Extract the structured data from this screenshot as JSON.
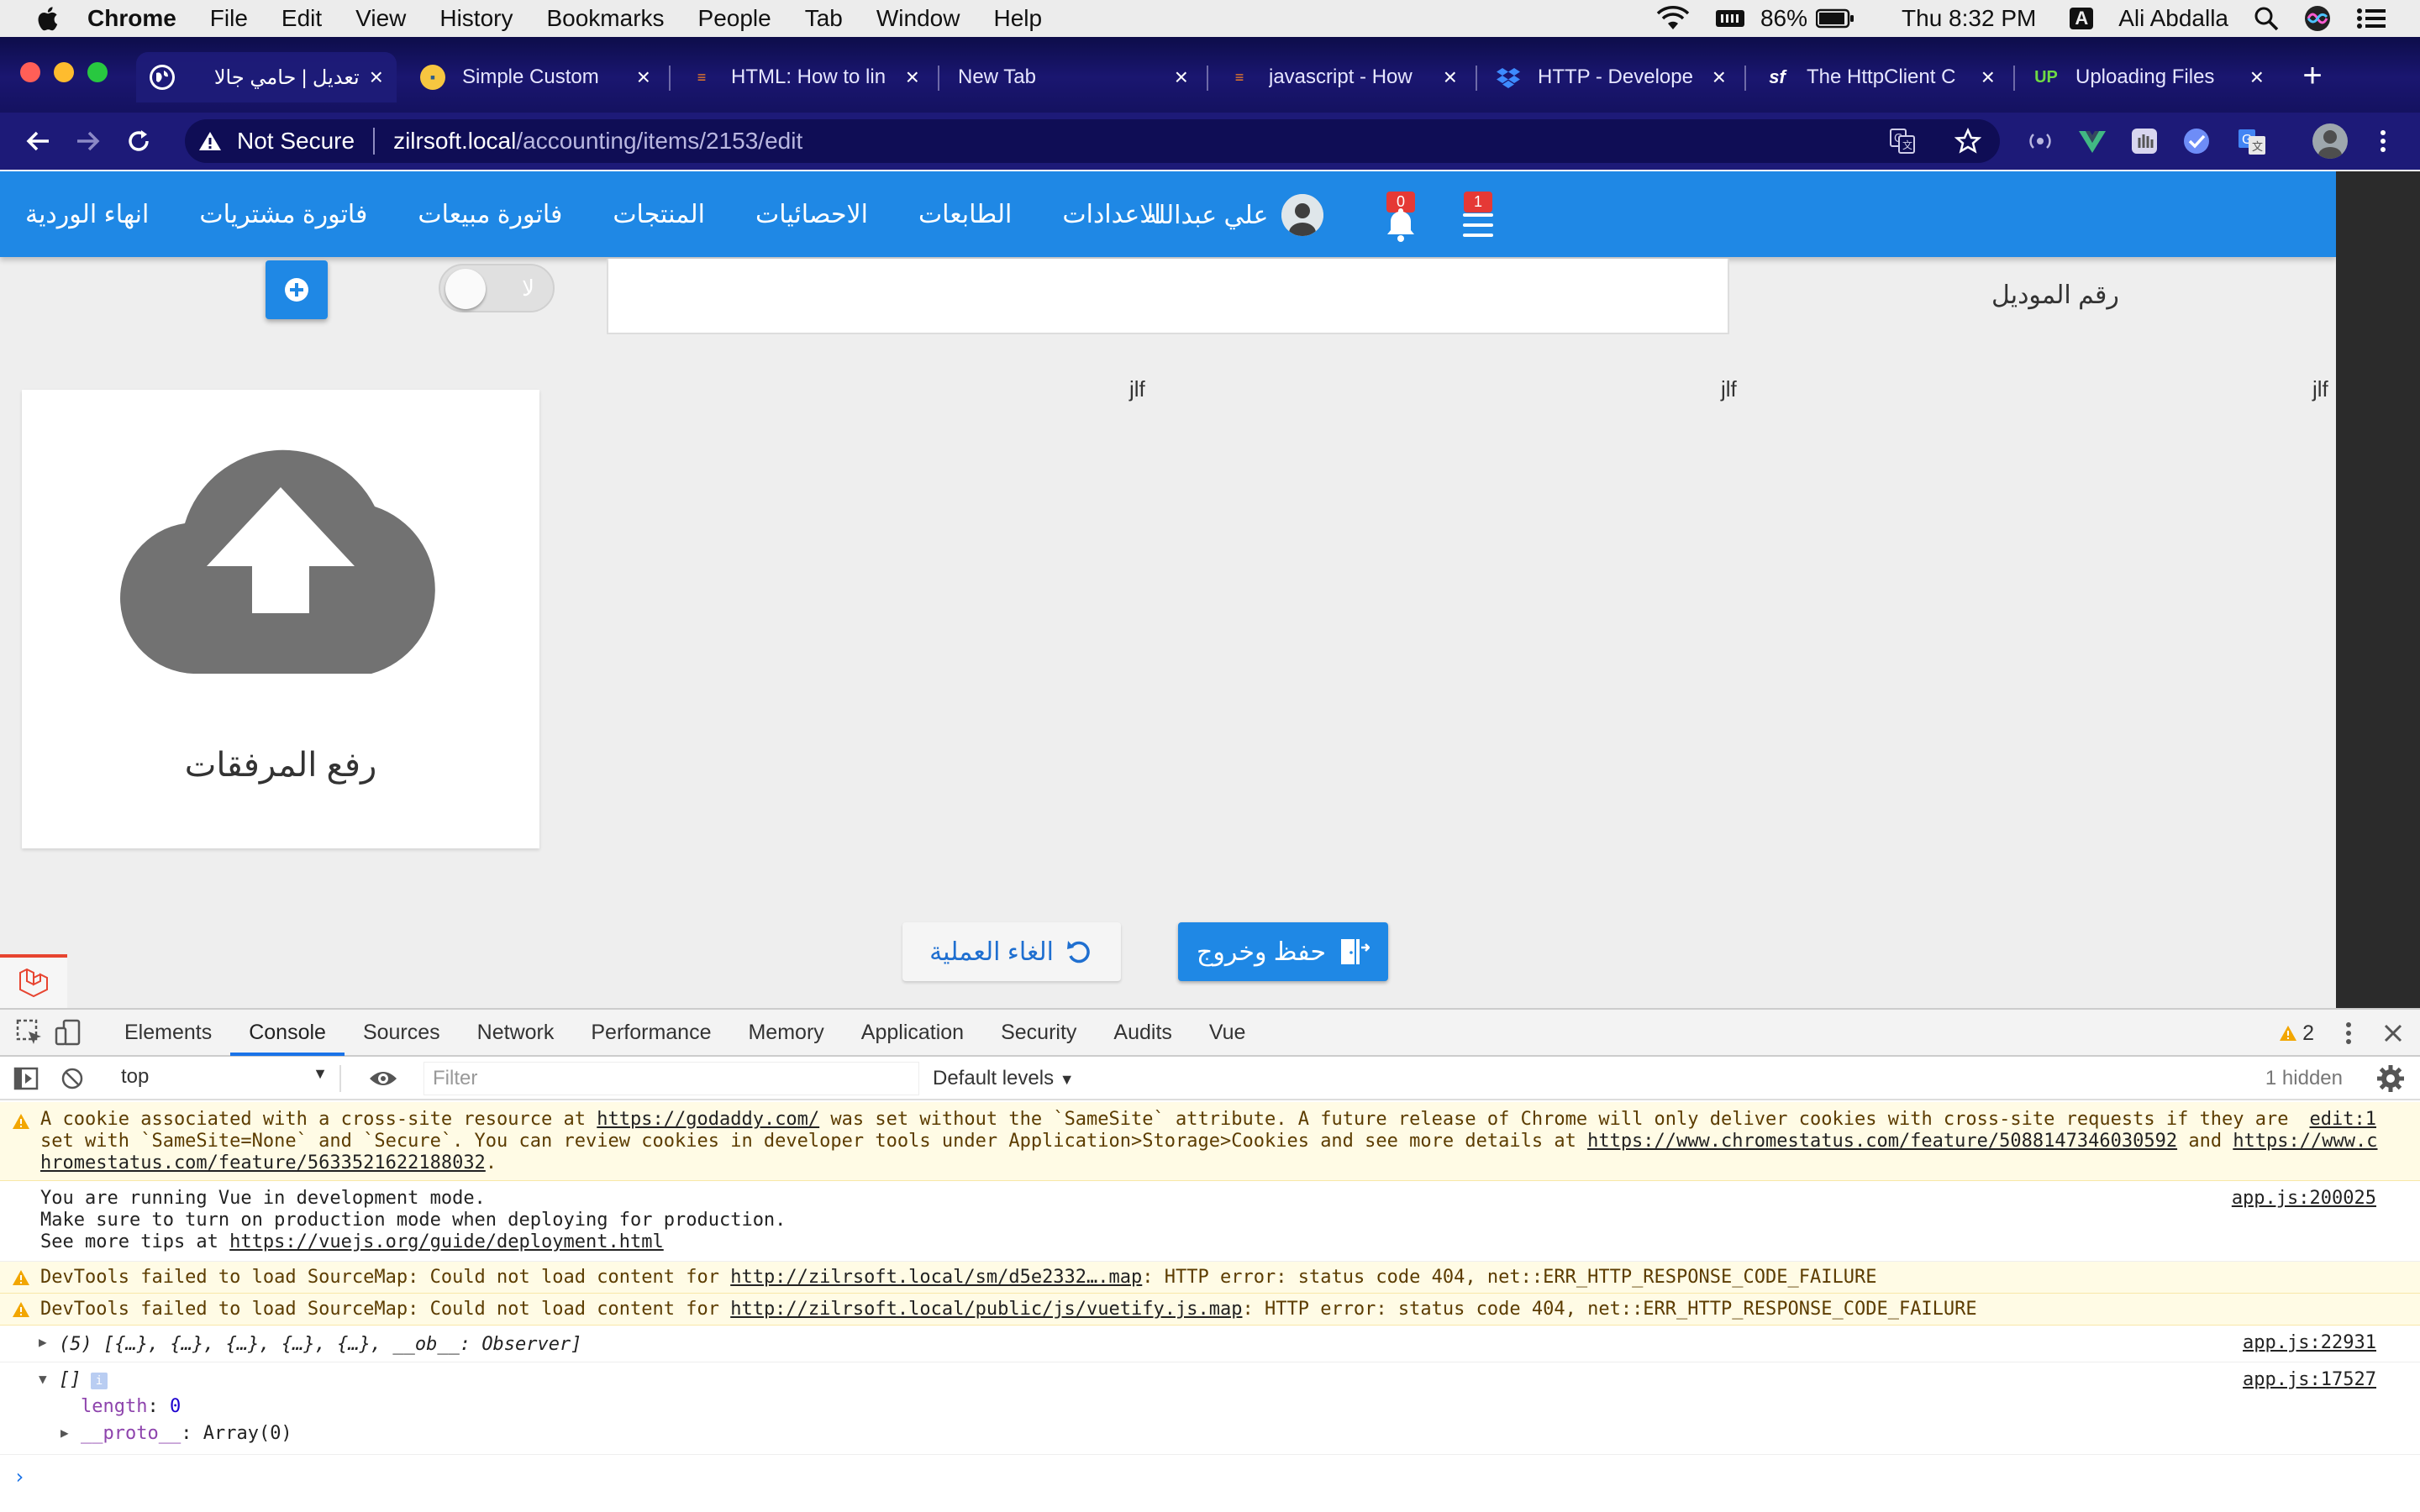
{
  "menubar": {
    "items": [
      "Chrome",
      "File",
      "Edit",
      "View",
      "History",
      "Bookmarks",
      "People",
      "Tab",
      "Window",
      "Help"
    ],
    "battery": "86%",
    "clock": "Thu 8:32 PM",
    "input_source": "A",
    "user": "Ali Abdalla"
  },
  "tabs": [
    {
      "label": "تعديل | حامي جالا",
      "icon": "globe-icon",
      "active": true
    },
    {
      "label": "Simple Custom",
      "icon": "python-icon"
    },
    {
      "label": "HTML: How to lin",
      "icon": "stackoverflow-icon"
    },
    {
      "label": "New Tab",
      "icon": ""
    },
    {
      "label": "javascript - How",
      "icon": "stackoverflow-icon"
    },
    {
      "label": "HTTP - Develope",
      "icon": "dropbox-icon"
    },
    {
      "label": "The HttpClient C",
      "icon": "symfony-icon"
    },
    {
      "label": "Uploading Files",
      "icon": "upwork-icon"
    }
  ],
  "omnibox": {
    "security": "Not Secure",
    "host": "zilrsoft.local",
    "path": "/accounting/items/2153/edit"
  },
  "app": {
    "nav": [
      "انهاء الوردية",
      "فاتورة مشتريات",
      "فاتورة مبيعات",
      "المنتجات",
      "الاحصائيات",
      "الطابعات",
      "الاعدادات"
    ],
    "user_name": "علي عبدالله",
    "notifications_count": "0",
    "menu_count": "1",
    "model_label": "رقم الموديل",
    "toggle_label": "لا",
    "jlf_labels": [
      "jlf",
      "jlf",
      "jlf"
    ],
    "upload_text": "رفع المرفقات",
    "cancel_label": "الغاء العملية",
    "save_label": "حفظ وخروج",
    "accent_color": "#1f88e5"
  },
  "devtools": {
    "tabs": [
      "Elements",
      "Console",
      "Sources",
      "Network",
      "Performance",
      "Memory",
      "Application",
      "Security",
      "Audits",
      "Vue"
    ],
    "active_tab": "Console",
    "warning_count": "2",
    "context": "top",
    "filter_placeholder": "Filter",
    "levels": "Default levels",
    "hidden": "1 hidden",
    "messages": {
      "cookie_line1_a": "A cookie associated with a cross-site resource at ",
      "cookie_link1": "https://godaddy.com/",
      "cookie_line1_b": " was set without the `SameSite` attribute. A future release of Chrome will only deliver cookies with cross-site requests if they are ",
      "cookie_src": "edit:1",
      "cookie_line2_a": "set with `SameSite=None` and `Secure`. You can review cookies in developer tools under Application>Storage>Cookies and see more details at ",
      "cookie_link2": "https://www.chromestatus.com/feature/5088147346030592",
      "cookie_line2_b": " and ",
      "cookie_link3a": "https://www.c",
      "cookie_link3b": "hromestatus.com/feature/5633521622188032",
      "vue_line1": "You are running Vue in development mode.",
      "vue_line2": "Make sure to turn on production mode when deploying for production.",
      "vue_line3_a": "See more tips at ",
      "vue_link": "https://vuejs.org/guide/deployment.html",
      "vue_src": "app.js:200025",
      "sm1_a": "DevTools failed to load SourceMap: Could not load content for ",
      "sm1_link": "http://zilrsoft.local/sm/d5e2332….map",
      "sm1_b": ": HTTP error: status code 404, net::ERR_HTTP_RESPONSE_CODE_FAILURE",
      "sm2_a": "DevTools failed to load SourceMap: Could not load content for ",
      "sm2_link": "http://zilrsoft.local/public/js/vuetify.js.map",
      "sm2_b": ": HTTP error: status code 404, net::ERR_HTTP_RESPONSE_CODE_FAILURE",
      "arr5": "(5) [{…}, {…}, {…}, {…}, {…}, __ob__: Observer]",
      "arr5_src": "app.js:22931",
      "empty_arr": "[]",
      "empty_src": "app.js:17527",
      "length_key": "length",
      "length_val": "0",
      "proto_key": "__proto__",
      "proto_val": "Array(0)"
    }
  }
}
